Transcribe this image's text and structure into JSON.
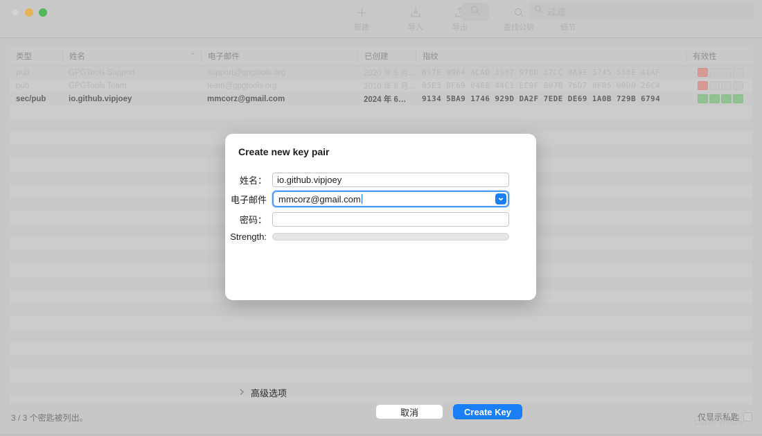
{
  "window": {
    "traffic_lights": [
      "close",
      "minimize",
      "maximize"
    ]
  },
  "toolbar": {
    "items": [
      {
        "icon": "plus-icon",
        "label": "新建"
      },
      {
        "icon": "import-icon",
        "label": "导入"
      },
      {
        "icon": "export-icon",
        "label": "导出"
      },
      {
        "icon": "search-key-icon",
        "label": "查找公钥"
      },
      {
        "icon": "info-icon",
        "label": "细节"
      }
    ],
    "search_button_icon": "search-icon",
    "filter_placeholder": "过滤"
  },
  "table": {
    "columns": [
      {
        "key": "type",
        "label": "类型"
      },
      {
        "key": "name",
        "label": "姓名",
        "sorted": "asc",
        "sort_glyph": "⌃"
      },
      {
        "key": "email",
        "label": "电子邮件"
      },
      {
        "key": "created",
        "label": "已创建"
      },
      {
        "key": "fingerprint",
        "label": "指纹"
      },
      {
        "key": "validity",
        "label": "有效性"
      }
    ],
    "rows": [
      {
        "type": "pub",
        "name": "GPGTools Support",
        "email": "support@gpgtools.org",
        "created": "2020 年 5 月…",
        "fingerprint": "B97E  9964  ACAD  1907  970D    37CC  8A9E  3745  558E  41AF",
        "validity": [
          "red",
          "empty",
          "empty",
          "empty"
        ],
        "current": false
      },
      {
        "type": "pub",
        "name": "GPGTools Team",
        "email": "team@gpgtools.org",
        "created": "2010 年 8 月…",
        "fingerprint": "85E3  8F69  046B  44C1  EC9F    B07B  76D7  8F05  00D0  26C4",
        "validity": [
          "red",
          "empty",
          "empty",
          "empty"
        ],
        "current": false
      },
      {
        "type": "sec/pub",
        "name": "io.github.vipjoey",
        "email": "mmcorz@gmail.com",
        "created": "2024 年 6…",
        "fingerprint": "9134  5BA9  1746  929D  DA2F    7EDE  DE69  1A0B  729B  6794",
        "validity": [
          "green",
          "green",
          "green",
          "green"
        ],
        "current": true
      }
    ]
  },
  "status": {
    "count_text": "3 / 3 个密匙被列出。",
    "secret_only_label": "仅显示私匙",
    "secret_only_checked": false,
    "watermark": "CSDN @hanyi_"
  },
  "dialog": {
    "title": "Create new key pair",
    "fields": {
      "name": {
        "label": "姓名：",
        "value": "io.github.vipjoey",
        "placeholder": ""
      },
      "email": {
        "label": "电子邮件",
        "value": "mmcorz@gmail.com",
        "placeholder": "",
        "focused": true,
        "dropdown_icon": "chevron-down-icon"
      },
      "password": {
        "label": "密码：",
        "value": "",
        "placeholder": ""
      },
      "strength": {
        "label": "Strength:",
        "value": 0
      }
    },
    "advanced": {
      "label": "高级选项",
      "icon": "chevron-right-icon",
      "expanded": false
    },
    "buttons": {
      "cancel": "取消",
      "create": "Create Key"
    }
  },
  "colors": {
    "accent": "#1a7ef5",
    "validity_red": "#e08680",
    "validity_green": "#7cc07c",
    "window_bg": "#c8c8c8"
  }
}
